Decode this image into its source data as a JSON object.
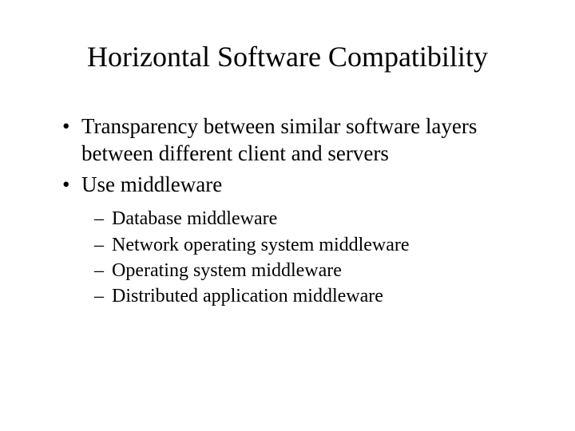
{
  "title": "Horizontal Software Compatibility",
  "bullets": [
    "Transparency between similar software layers between different client and servers",
    "Use middleware"
  ],
  "subbullets": [
    "Database middleware",
    "Network operating system middleware",
    "Operating system middleware",
    "Distributed application middleware"
  ]
}
